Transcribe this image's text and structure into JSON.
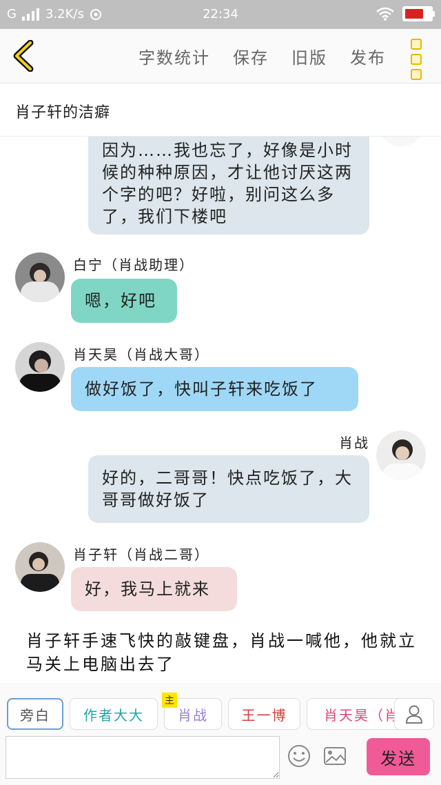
{
  "status_bar": {
    "network": "G",
    "speed": "3.2K/s",
    "time": "22:34"
  },
  "toolbar": {
    "word_count_label": "字数统计",
    "save_label": "保存",
    "old_version_label": "旧版",
    "publish_label": "发布"
  },
  "story": {
    "title": "肖子轩的洁癖"
  },
  "messages": [
    {
      "side": "right",
      "name": "",
      "text": "因为……我也忘了，好像是小时候的种种原因，才让他讨厌这两个字的吧？好啦，别问这么多了，我们下楼吧",
      "color": "#dce6ec"
    },
    {
      "side": "left",
      "name": "白宁（肖战助理）",
      "text": "嗯，好吧",
      "color": "#7fd6c4"
    },
    {
      "side": "left",
      "name": "肖天昊（肖战大哥）",
      "text": "做好饭了，快叫子轩来吃饭了",
      "color": "#9fd8f6"
    },
    {
      "side": "right",
      "name": "肖战",
      "text": "好的，二哥哥！快点吃饭了，大哥哥做好饭了",
      "color": "#dce6ec"
    },
    {
      "side": "left",
      "name": "肖子轩（肖战二哥）",
      "text": "好，我马上就来",
      "color": "#f4dcdc"
    }
  ],
  "narration": "肖子轩手速飞快的敲键盘，肖战一喊他，他就立马关上电脑出去了",
  "characters": [
    {
      "label": "旁白",
      "color": "#555555",
      "active": true
    },
    {
      "label": "作者大大",
      "color": "#1aa8a8",
      "active": false
    },
    {
      "label": "肖战",
      "color": "#9a7fd6",
      "active": false,
      "badge": "主"
    },
    {
      "label": "王一博",
      "color": "#d93a3a",
      "active": false
    },
    {
      "label": "肖天昊（肖",
      "color": "#e0457a",
      "active": false
    }
  ],
  "composer": {
    "send_label": "发送",
    "input_value": ""
  }
}
